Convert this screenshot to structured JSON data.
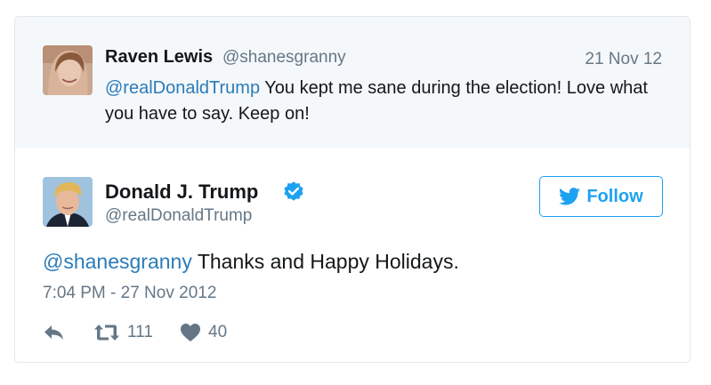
{
  "parent_tweet": {
    "name": "Raven Lewis",
    "handle": "@shanesgranny",
    "date": "21 Nov 12",
    "mention": "@realDonaldTrump",
    "text": " You kept me sane during the election! Love what you have to say. Keep on!"
  },
  "main_tweet": {
    "name": "Donald J. Trump",
    "handle": "@realDonaldTrump",
    "follow_label": "Follow",
    "mention": "@shanesgranny",
    "text": " Thanks and Happy Holidays.",
    "timestamp": "7:04 PM - 27 Nov 2012",
    "retweet_count": "111",
    "like_count": "40"
  },
  "colors": {
    "accent": "#1da1f2",
    "mention": "#2b7bb9",
    "muted": "#657786",
    "parent_bg": "#f5f8fa",
    "border": "#e1e8ed"
  },
  "icons": [
    "verified-badge-icon",
    "twitter-bird-icon",
    "reply-icon",
    "retweet-icon",
    "heart-icon"
  ]
}
